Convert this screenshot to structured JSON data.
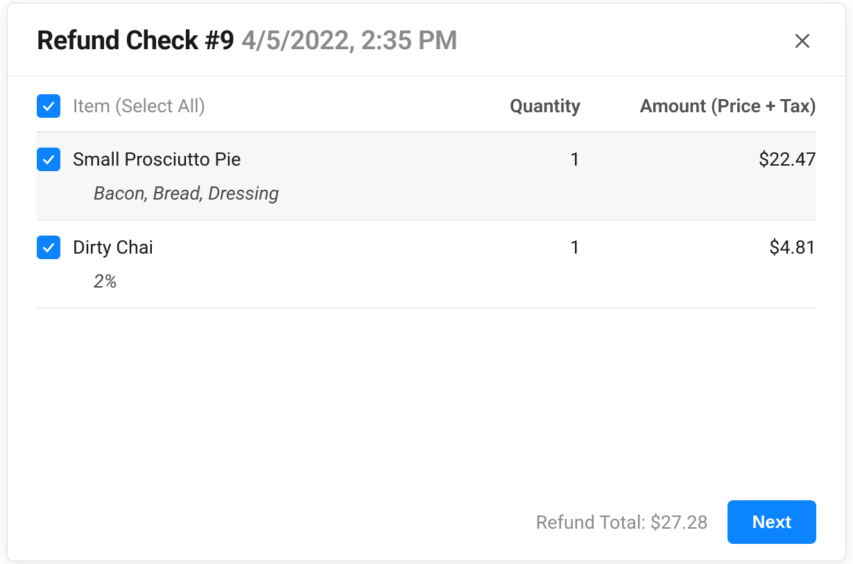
{
  "header": {
    "title": "Refund Check #9",
    "timestamp": "4/5/2022, 2:35 PM"
  },
  "columns": {
    "item": "Item (Select All)",
    "quantity": "Quantity",
    "amount": "Amount (Price + Tax)"
  },
  "items": [
    {
      "name": "Small Prosciutto Pie",
      "modifiers": "Bacon, Bread, Dressing",
      "quantity": "1",
      "amount": "$22.47",
      "checked": true,
      "highlighted": true
    },
    {
      "name": "Dirty Chai",
      "modifiers": "2%",
      "quantity": "1",
      "amount": "$4.81",
      "checked": true,
      "highlighted": false
    }
  ],
  "footer": {
    "total_label": "Refund Total:",
    "total_value": "$27.28",
    "next_label": "Next"
  }
}
